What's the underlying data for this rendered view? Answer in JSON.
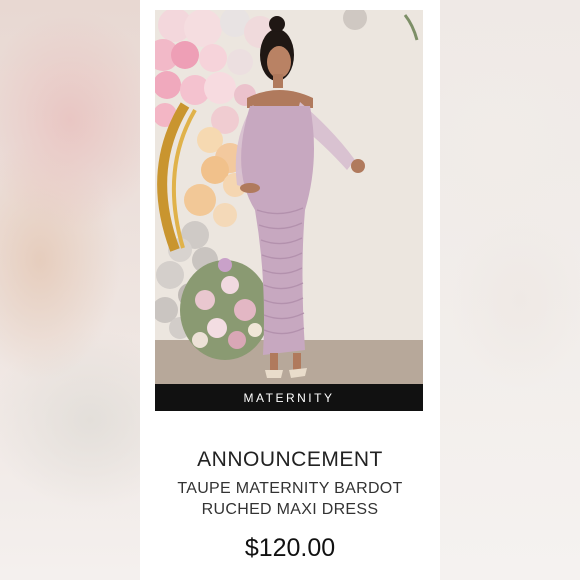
{
  "product": {
    "badge": "MATERNITY",
    "title": "ANNOUNCEMENT",
    "subtitle_line1": "TAUPE MATERNITY BARDOT",
    "subtitle_line2": "RUCHED MAXI DRESS",
    "price": "$120.00"
  },
  "colors": {
    "dress": "#c7a8c0",
    "badge_bg": "#111111",
    "card_bg": "#ffffff"
  }
}
